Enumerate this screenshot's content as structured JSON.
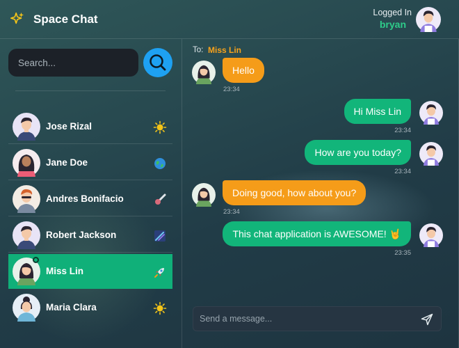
{
  "header": {
    "app_title": "Space Chat",
    "logo_icon": "sparkles-icon",
    "logged_in_label": "Logged In",
    "username": "bryan"
  },
  "sidebar": {
    "search_placeholder": "Search...",
    "search_icon": "search-icon",
    "contacts": [
      {
        "name": "Jose Rizal",
        "status_icon": "sun-icon",
        "active": false
      },
      {
        "name": "Jane Doe",
        "status_icon": "earth-icon",
        "active": false
      },
      {
        "name": "Andres Bonifacio",
        "status_icon": "comet-icon",
        "active": false
      },
      {
        "name": "Robert Jackson",
        "status_icon": "shooting-star-icon",
        "active": false
      },
      {
        "name": "Miss Lin",
        "status_icon": "rocket-icon",
        "active": true
      },
      {
        "name": "Maria Clara",
        "status_icon": "sun-icon",
        "active": false
      }
    ]
  },
  "chat": {
    "to_label": "To:",
    "recipient": "Miss Lin",
    "messages": [
      {
        "text": "Hello",
        "time": "23:34",
        "direction": "incoming"
      },
      {
        "text": "Hi Miss Lin",
        "time": "23:34",
        "direction": "outgoing"
      },
      {
        "text": "How are you today?",
        "time": "23:34",
        "direction": "outgoing"
      },
      {
        "text": "Doing good, how about you?",
        "time": "23:34",
        "direction": "incoming"
      },
      {
        "text": "This chat application is AWESOME! 🤘",
        "time": "23:35",
        "direction": "outgoing"
      }
    ],
    "composer_placeholder": "Send a message...",
    "send_icon": "send-icon"
  },
  "colors": {
    "accent_green": "#10b079",
    "accent_orange": "#f59c19",
    "accent_blue": "#1ea1f2"
  }
}
